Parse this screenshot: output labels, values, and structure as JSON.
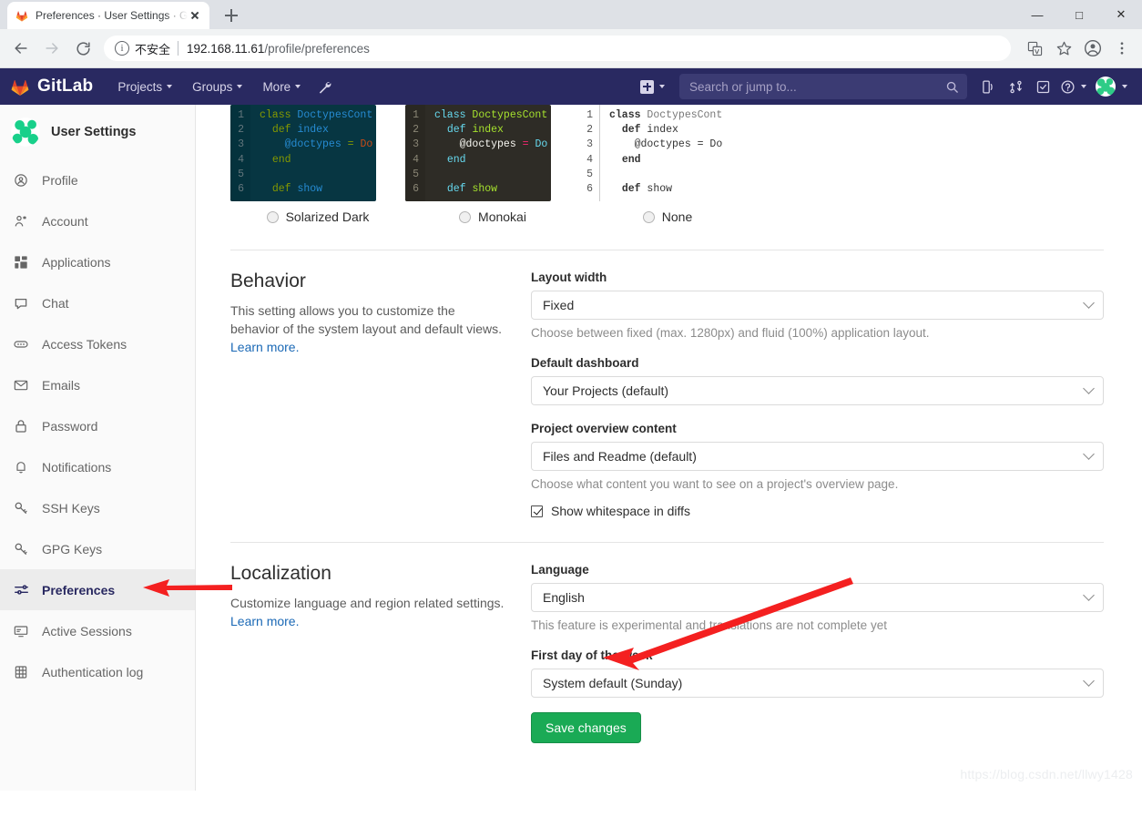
{
  "browser": {
    "tab": {
      "title": "Preferences · User Settings · G",
      "favicon": "gitlab-fox-icon",
      "close": "close-icon"
    },
    "newtab_label": "+",
    "window_controls": {
      "minimize": "—",
      "maximize": "□",
      "close": "✕"
    },
    "nav": {
      "back": "back-arrow-icon",
      "forward": "forward-arrow-icon",
      "reload": "reload-icon"
    },
    "omnibox": {
      "info_glyph": "i",
      "security_text": "不安全",
      "url_host": "192.168.11.61",
      "url_path": "/profile/preferences"
    },
    "toolbar_icons": [
      "translate-icon",
      "bookmark-star-icon",
      "profile-avatar-icon",
      "chrome-menu-icon"
    ]
  },
  "gitlab_nav": {
    "brand": "GitLab",
    "items": [
      {
        "label": "Projects",
        "caret": true
      },
      {
        "label": "Groups",
        "caret": true
      },
      {
        "label": "More",
        "caret": true
      }
    ],
    "admin_icon": "wrench-icon",
    "create_new": {
      "icon": "plus-square-icon",
      "caret": true
    },
    "search": {
      "placeholder": "Search or jump to...",
      "value": "",
      "icon": "search-icon"
    },
    "right_icons": [
      "todos-icon",
      "merge-requests-icon",
      "issues-icon",
      "help-icon"
    ],
    "avatar": "user-avatar"
  },
  "sidebar": {
    "title": "User Settings",
    "avatar": "user-avatar",
    "items": [
      {
        "label": "Profile",
        "icon": "profile-icon",
        "active": false
      },
      {
        "label": "Account",
        "icon": "account-icon",
        "active": false
      },
      {
        "label": "Applications",
        "icon": "applications-icon",
        "active": false
      },
      {
        "label": "Chat",
        "icon": "chat-icon",
        "active": false
      },
      {
        "label": "Access Tokens",
        "icon": "access-tokens-icon",
        "active": false
      },
      {
        "label": "Emails",
        "icon": "emails-icon",
        "active": false
      },
      {
        "label": "Password",
        "icon": "password-lock-icon",
        "active": false
      },
      {
        "label": "Notifications",
        "icon": "notifications-bell-icon",
        "active": false
      },
      {
        "label": "SSH Keys",
        "icon": "ssh-key-icon",
        "active": false
      },
      {
        "label": "GPG Keys",
        "icon": "gpg-key-icon",
        "active": false
      },
      {
        "label": "Preferences",
        "icon": "preferences-sliders-icon",
        "active": true
      },
      {
        "label": "Active Sessions",
        "icon": "active-sessions-icon",
        "active": false
      },
      {
        "label": "Authentication log",
        "icon": "authentication-log-icon",
        "active": false
      }
    ]
  },
  "syntax_themes": {
    "code_lines": [
      "1",
      "2",
      "3",
      "4",
      "5",
      "6"
    ],
    "code_snippet": "class DoctypesCont\n  def index\n    @doctypes = Do\n  end\n\n  def show",
    "options": [
      {
        "label": "Solarized Dark",
        "selected": false
      },
      {
        "label": "Monokai",
        "selected": false
      },
      {
        "label": "None",
        "selected": false
      }
    ]
  },
  "behavior": {
    "heading": "Behavior",
    "description": "This setting allows you to customize the behavior of the system layout and default views.",
    "learn_more": "Learn more.",
    "fields": [
      {
        "label": "Layout width",
        "value": "Fixed",
        "help": "Choose between fixed (max. 1280px) and fluid (100%) application layout."
      },
      {
        "label": "Default dashboard",
        "value": "Your Projects (default)",
        "help": ""
      },
      {
        "label": "Project overview content",
        "value": "Files and Readme (default)",
        "help": "Choose what content you want to see on a project's overview page."
      }
    ],
    "checkbox": {
      "label": "Show whitespace in diffs",
      "checked": true
    }
  },
  "localization": {
    "heading": "Localization",
    "description": "Customize language and region related settings.",
    "learn_more": "Learn more.",
    "fields": [
      {
        "label": "Language",
        "value": "English",
        "help": "This feature is experimental and translations are not complete yet"
      },
      {
        "label": "First day of the week",
        "value": "System default (Sunday)",
        "help": ""
      }
    ],
    "save_button": "Save changes"
  },
  "annotations": {
    "arrow_color": "#f42020",
    "arrow_1_target": "sidebar-item-preferences",
    "arrow_2_target": "language-select"
  },
  "watermark": "https://blog.csdn.net/llwy1428",
  "colors": {
    "gitlab_navy": "#292961",
    "accent_green": "#1aaa55",
    "link_blue": "#1b69b6",
    "arrow_red": "#f42020"
  }
}
